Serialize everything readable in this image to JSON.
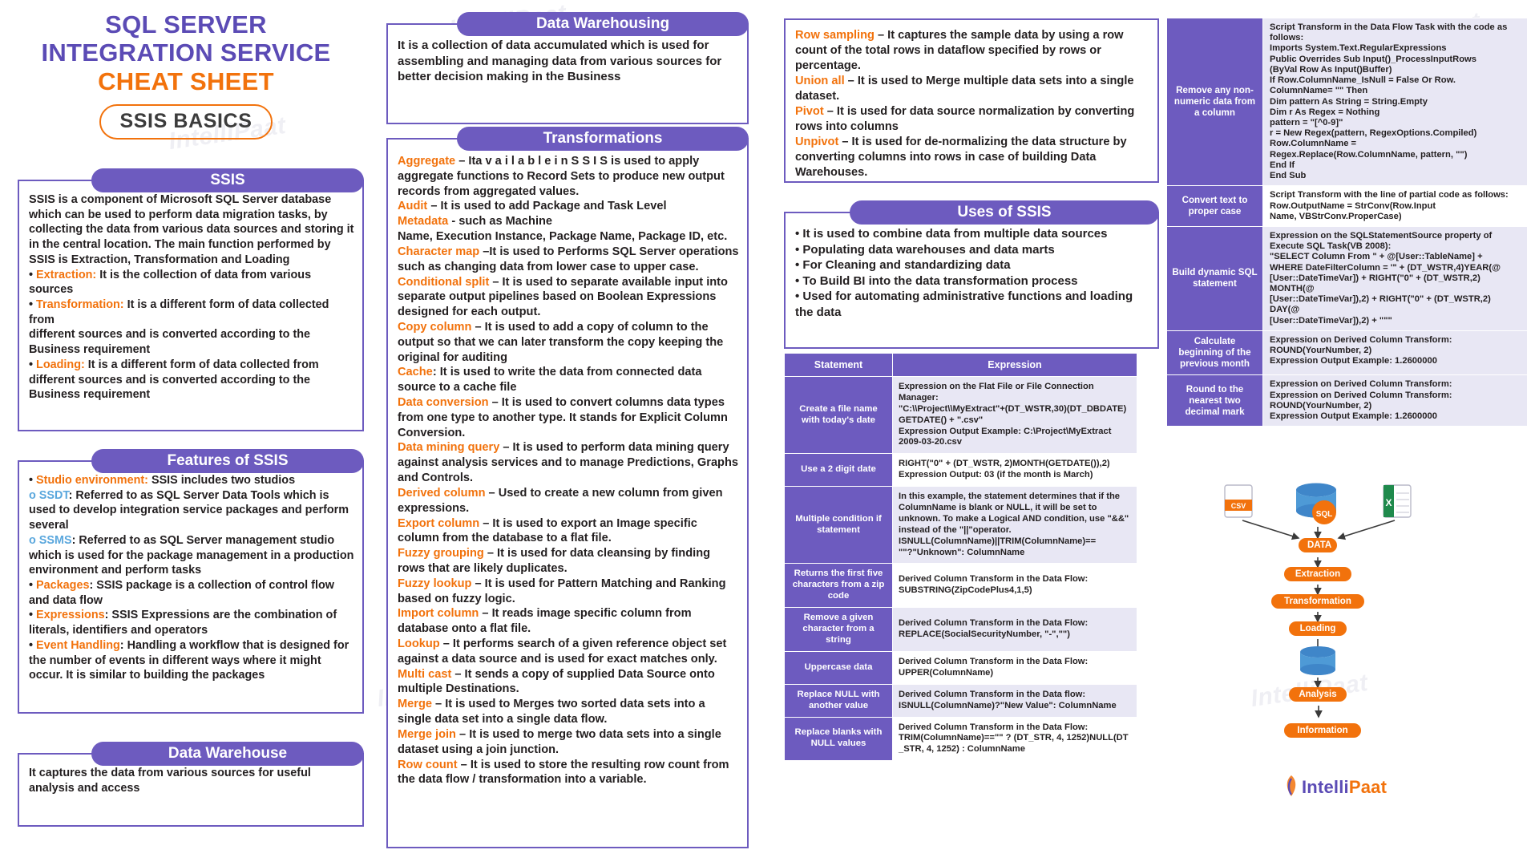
{
  "title": {
    "line1": "SQL SERVER",
    "line2": "INTEGRATION SERVICE",
    "line3": "CHEAT SHEET",
    "badge": "SSIS BASICS"
  },
  "watermark": "IntelliPaat",
  "colors": {
    "purple": "#6d5bbf",
    "title_purple": "#5b4bb5",
    "orange": "#f2720c",
    "blue": "#5aa7dd",
    "table_alt": "#e8e7f4"
  },
  "cards": {
    "ssis": {
      "heading": "SSIS",
      "body_html": "SSIS is a component of Microsoft SQL Server database which can be used to perform data migration tasks, by collecting the data from various data sources and storing it in the central location. The main function performed by SSIS is Extraction, Transformation and Loading<br>• <span class=\"or\">Extraction:</span> It is the collection of data from various sources<br>• <span class=\"or\">Transformation:</span> It is a different form of data collected from<br>different sources and is converted according to the Business requirement<br>• <span class=\"or\">Loading:</span> It is a different form of data collected from different sources and is converted according to the Business requirement"
    },
    "features": {
      "heading": "Features of SSIS",
      "body_html": "• <span class=\"or\">Studio environment:</span> SSIS includes two studios<br><span class=\"bl\">o SSDT</span>: Referred to as SQL Server Data Tools which is used to develop integration service packages and perform several<br><span class=\"bl\">o SSMS</span>: Referred to as SQL Server management studio which is used for the package management in a production environment and perform tasks<br>• <span class=\"or\">Packages</span>: SSIS package is a collection of control flow and data flow<br>• <span class=\"or\">Expressions</span>: SSIS Expressions are the combination of literals, identifiers and operators<br>• <span class=\"or\">Event Handling</span>: Handling a workflow that is designed for the number of events in different ways where it might occur. It is similar to building the packages"
    },
    "data_warehouse": {
      "heading": "Data Warehouse",
      "body_html": "It captures the data from various sources for useful analysis and access"
    },
    "data_warehousing": {
      "heading": "Data Warehousing",
      "body_html": "It is a collection of data accumulated which is used for assembling and managing data from various sources for better decision making in the Business"
    },
    "transformations": {
      "heading": "Transformations",
      "body_html": "<span class=\"or\">Aggregate</span> – Ita v a i l a b l e i n S S I S is used to apply aggregate functions to Record Sets to produce new output records from aggregated values.<br><span class=\"or\">Audit</span> – It is used to add Package and Task Level<br><span class=\"or\">Metadata</span> - such as Machine<br>Name, Execution Instance, Package Name, Package ID, etc.<br><span class=\"or\">Character map</span> –It is used to Performs SQL Server operations such as changing data from lower case to upper case.<br><span class=\"or\">Conditional split</span> – It is used to separate available input into separate output pipelines based on Boolean Expressions designed for each output.<br><span class=\"or\">Copy column</span> – It is used to add a copy of column to the output so that we can later transform the copy keeping the original for auditing<br><span class=\"or\">Cache</span>: It is used to write the data from connected data source to a cache file<br><span class=\"or\">Data conversion</span> – It is used to convert columns data types from one type to another type. It stands for Explicit Column Conversion.<br><span class=\"or\">Data mining query</span> – It is used to perform data mining query against analysis services and to manage Predictions, Graphs and Controls.<br><span class=\"or\">Derived column</span> – Used to create a new column from given expressions.<br><span class=\"or\">Export column</span> – It is used to export an Image specific column from the database to a flat file.<br><span class=\"or\">Fuzzy grouping</span> – It is used for data cleansing by finding rows that are likely duplicates.<br><span class=\"or\">Fuzzy lookup</span> – It is used for Pattern Matching and Ranking based on fuzzy logic.<br><span class=\"or\">Import column</span> – It reads image specific column from database onto a flat file.<br><span class=\"or\">Lookup</span> – It performs search of a given reference object set against a data source and is used for exact matches only.<br><span class=\"or\">Multi cast</span> – It sends a copy of supplied Data Source onto multiple Destinations.<br><span class=\"or\">Merge</span> – It is used to Merges two sorted data sets into a single data set into a single data flow.<br><span class=\"or\">Merge join</span> – It is used to merge two data sets into a single dataset using a join junction.<br><span class=\"or\">Row count</span> – It is used to store the resulting row count from the data flow / transformation into a variable."
    },
    "row_sampling": {
      "body_html": "<span class=\"or\">Row sampling</span> – It captures the sample data by using a row count of the total rows in dataflow specified by rows or percentage.<br><span class=\"or\">Union all</span> – It is used to Merge multiple data sets into a single dataset.<br><span class=\"or\">Pivot</span> – It is used for data source normalization by converting rows into columns<br><span class=\"or\">Unpivot</span> – It is used for de-normalizing the data structure by converting columns into rows in case of building Data Warehouses."
    },
    "uses": {
      "heading": "Uses of SSIS",
      "body_html": "• It is used to combine data from multiple data sources<br>• Populating data warehouses and data marts<br>• For Cleaning and standardizing data<br>• To Build BI into the data transformation process<br>• Used for automating administrative functions and loading the data"
    }
  },
  "expression_table": {
    "headers": [
      "Statement",
      "Expression"
    ],
    "rows": [
      {
        "statement": "Create a file name with today's date",
        "expression": "Expression on the Flat File or File Connection Manager:\n\"C:\\\\Project\\\\MyExtract\"+(DT_WSTR,30)(DT_DBDATE)\nGETDATE() + \".csv\"\nExpression Output Example: C:\\Project\\MyExtract\n2009-03-20.csv"
      },
      {
        "statement": "Use a 2 digit date",
        "expression": "RIGHT(\"0\" + (DT_WSTR, 2)MONTH(GETDATE()),2)\nExpression Output: 03 (if the month is March)"
      },
      {
        "statement": "Multiple condition if statement",
        "expression": "In this example, the statement determines that if the ColumnName is blank or NULL, it will be set to unknown. To make a Logical AND condition, use \"&&\" instead of the \"||\"operator.\nISNULL(ColumnName)||TRIM(ColumnName)==\n\"\"?\"Unknown\": ColumnName"
      },
      {
        "statement": "Returns the first five characters from a zip code",
        "expression": "Derived Column Transform in the Data Flow:\nSUBSTRING(ZipCodePlus4,1,5)"
      },
      {
        "statement": "Remove a given character from a string",
        "expression": "Derived Column Transform in the Data Flow:\nREPLACE(SocialSecurityNumber, \"-\",\"\")"
      },
      {
        "statement": "Uppercase data",
        "expression": "Derived Column Transform in the Data Flow:\nUPPER(ColumnName)"
      },
      {
        "statement": "Replace NULL with another value",
        "expression": "Derived Column Transform in the Data flow:\nISNULL(ColumnName)?\"New Value\": ColumnName"
      },
      {
        "statement": "Replace blanks with NULL values",
        "expression": "Derived Column Transform in the Data Flow:\nTRIM(ColumnName)==\"\" ? (DT_STR, 4, 1252)NULL(DT\n_STR, 4, 1252) : ColumnName"
      }
    ]
  },
  "code_table": {
    "rows": [
      {
        "label": "Remove any non-numeric data from a column",
        "code": "Script Transform in the Data Flow Task with the code as follows:\nImports System.Text.RegularExpressions\nPublic Overrides Sub Input()_ProcessInputRows\n(ByVal Row As Input()Buffer)\nIf Row.ColumnName_IsNull = False Or Row.\nColumnName= \"\" Then\nDim pattern As String = String.Empty\nDim r As Regex = Nothing\npattern = \"[^0-9]\"\nr = New Regex(pattern, RegexOptions.Compiled)\nRow.ColumnName =\nRegex.Replace(Row.ColumnName, pattern, \"\")\nEnd If\nEnd Sub"
      },
      {
        "label": "Convert text to proper case",
        "code": "Script Transform with the line of partial code as follows: Row.OutputName = StrConv(Row.Input\nName, VBStrConv.ProperCase)"
      },
      {
        "label": "Build dynamic SQL statement",
        "code": "Expression on the SQLStatementSource property of Execute SQL Task(VB 2008):\n\"SELECT Column From \" + @[User::TableName] +\nWHERE DateFilterColumn = '\" + (DT_WSTR,4)YEAR(@\n[User::DateTimeVar]) + RIGHT(\"0\" + (DT_WSTR,2)\nMONTH(@\n[User::DateTimeVar]),2) + RIGHT(\"0\" + (DT_WSTR,2)\nDAY(@\n[User::DateTimeVar]),2) + \"\"\""
      },
      {
        "label": "Calculate beginning of the previous month",
        "code": "Expression on Derived Column Transform:\nROUND(YourNumber, 2)\nExpression Output Example: 1.2600000"
      },
      {
        "label": "Round to the nearest two decimal mark",
        "code": "Expression on Derived Column Transform:\nExpression on Derived Column Transform:\nROUND(YourNumber, 2)\nExpression Output Example: 1.2600000"
      }
    ]
  },
  "flow_diagram": {
    "sources": [
      {
        "name": "csv-file-icon",
        "label": "CSV"
      },
      {
        "name": "sql-database-icon",
        "label": "SQL"
      },
      {
        "name": "excel-file-icon",
        "label": "X"
      }
    ],
    "nodes": [
      {
        "label": "DATA"
      },
      {
        "label": "Extraction"
      },
      {
        "label": "Transformation"
      },
      {
        "label": "Loading"
      },
      {
        "label": "Analysis"
      },
      {
        "label": "Information"
      }
    ],
    "brand": {
      "part1": "Intelli",
      "part2": "Paat"
    }
  }
}
